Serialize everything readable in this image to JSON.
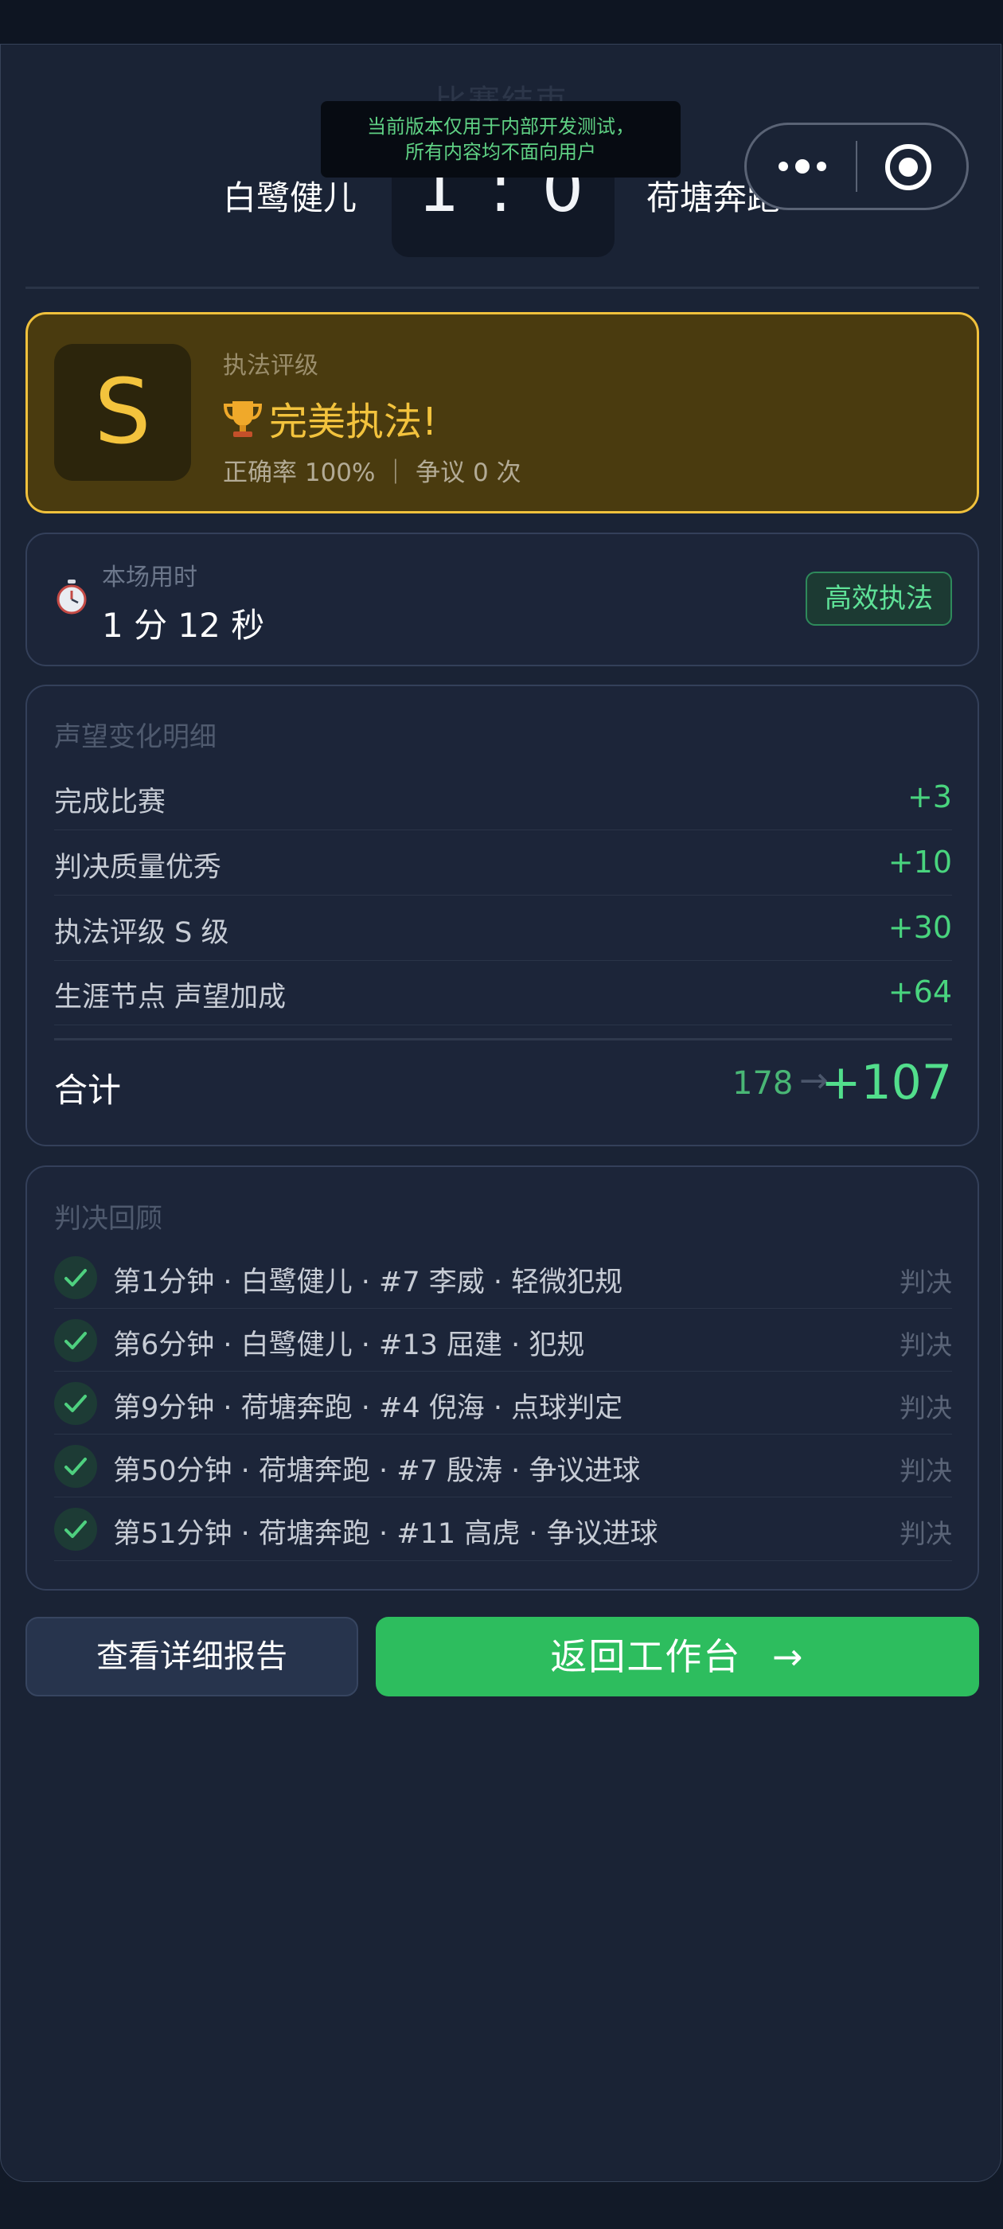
{
  "header": {
    "title": "比赛结束",
    "home_team": "白鹭健儿",
    "away_team": "荷塘奔跑",
    "score": "1 : 0"
  },
  "dev_banner": {
    "line1": "当前版本仅用于内部开发测试，",
    "line2": "所有内容均不面向用户"
  },
  "capsule": {
    "more_icon": "more-dots-icon",
    "close_icon": "target-icon"
  },
  "grade": {
    "label": "执法评级",
    "letter": "S",
    "title": "完美执法!",
    "title_icon": "trophy-icon",
    "subtitle": "正确率 100% ｜ 争议 0 次"
  },
  "time": {
    "label": "本场用时",
    "value": "1 分 12 秒",
    "icon": "stopwatch-icon",
    "badge": "高效执法"
  },
  "reputation": {
    "title": "声望变化明细",
    "rows": [
      {
        "label": "完成比赛",
        "value": "+3"
      },
      {
        "label": "判决质量优秀",
        "value": "+10"
      },
      {
        "label": "执法评级 S 级",
        "value": "+30"
      },
      {
        "label": "生涯节点 声望加成",
        "value": "+64"
      }
    ],
    "total_label": "合计",
    "total_from": "178",
    "total_arrow": "→",
    "total_value": "+107"
  },
  "review": {
    "title": "判决回顾",
    "items": [
      {
        "text": "第1分钟 · 白鹭健儿 · #7 李威 · 轻微犯规",
        "tag": "判决"
      },
      {
        "text": "第6分钟 · 白鹭健儿 · #13 屈建 · 犯规",
        "tag": "判决"
      },
      {
        "text": "第9分钟 · 荷塘奔跑 · #4 倪海 · 点球判定",
        "tag": "判决"
      },
      {
        "text": "第50分钟 · 荷塘奔跑 · #7 殷涛 · 争议进球",
        "tag": "判决"
      },
      {
        "text": "第51分钟 · 荷塘奔跑 · #11 高虎 · 争议进球",
        "tag": "判决"
      }
    ]
  },
  "actions": {
    "detail_button": "查看详细报告",
    "return_button": "返回工作台",
    "return_arrow": "→"
  },
  "colors": {
    "accent_gold": "#f3c33d",
    "accent_green": "#2dbd5e",
    "positive": "#49d47e"
  }
}
